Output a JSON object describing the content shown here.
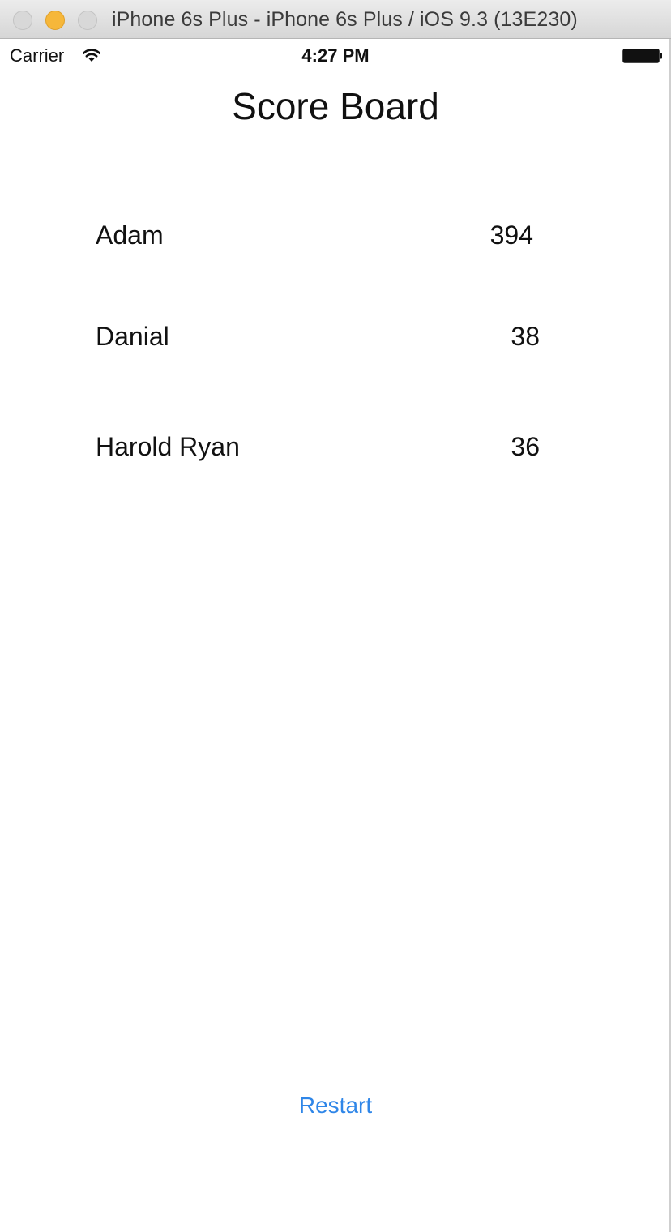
{
  "window": {
    "title": "iPhone 6s Plus - iPhone 6s Plus / iOS 9.3 (13E230)"
  },
  "status_bar": {
    "carrier": "Carrier",
    "time": "4:27 PM",
    "icons": [
      "wifi-icon",
      "battery-icon"
    ]
  },
  "screen": {
    "title": "Score Board",
    "scores": [
      {
        "name": "Adam",
        "score": "394"
      },
      {
        "name": "Danial",
        "score": "38"
      },
      {
        "name": "Harold Ryan",
        "score": "36"
      }
    ],
    "restart_label": "Restart"
  },
  "colors": {
    "accent": "#2f86e8",
    "minimize_button": "#f6b73a"
  }
}
